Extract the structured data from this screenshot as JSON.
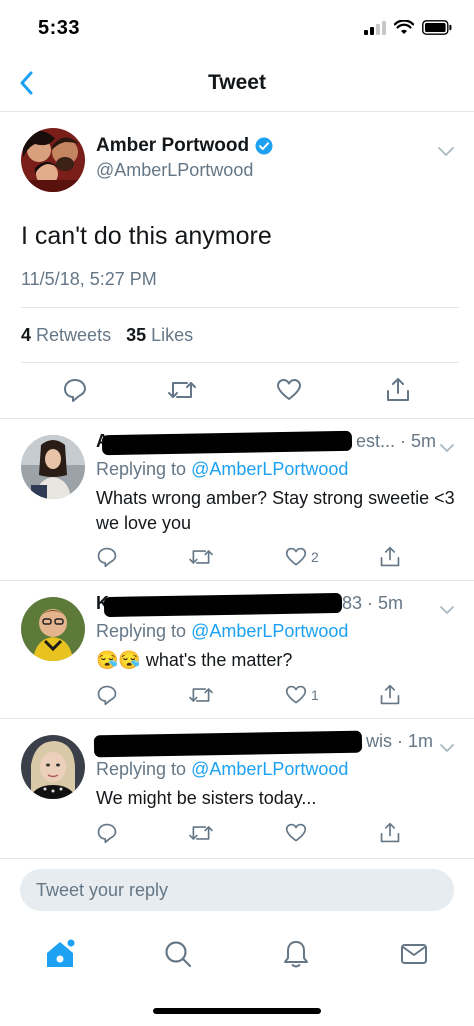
{
  "status_bar": {
    "time": "5:33"
  },
  "nav": {
    "title": "Tweet"
  },
  "tweet": {
    "author_name": "Amber Portwood",
    "author_handle": "@AmberLPortwood",
    "text": "I can't do this anymore",
    "timestamp": "11/5/18, 5:27 PM",
    "retweets_count": "4",
    "retweets_label": "Retweets",
    "likes_count": "35",
    "likes_label": "Likes"
  },
  "replies": [
    {
      "name_fragment": "A",
      "header_tail": "est... · 5m",
      "replying_prefix": "Replying to",
      "mention": "@AmberLPortwood",
      "text": "Whats wrong amber? Stay strong sweetie <3 we love you",
      "like_count": "2"
    },
    {
      "name_fragment": "K",
      "header_tail": "83 · 5m",
      "replying_prefix": "Replying to",
      "mention": "@AmberLPortwood",
      "emoji": "😪😪",
      "text": "what's the matter?",
      "like_count": "1"
    },
    {
      "name_fragment": "",
      "header_tail": "wis · 1m",
      "replying_prefix": "Replying to",
      "mention": "@AmberLPortwood",
      "text": "We might be sisters today...",
      "like_count": ""
    }
  ],
  "reply_box": {
    "placeholder": "Tweet your reply"
  },
  "colors": {
    "accent": "#1da1f2",
    "secondary_text": "#657786",
    "divider": "#e1e8ed"
  },
  "icons": {
    "tab_bar": [
      "home-icon",
      "search-icon",
      "notifications-icon",
      "messages-icon"
    ],
    "actions": [
      "reply-icon",
      "retweet-icon",
      "like-icon",
      "share-icon"
    ]
  }
}
